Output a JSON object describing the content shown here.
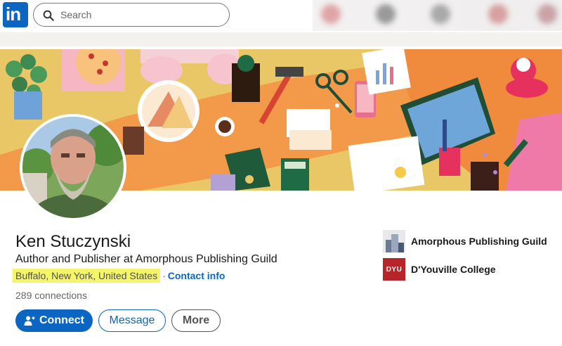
{
  "nav": {
    "logo_text": "in",
    "search_placeholder": "Search"
  },
  "profile": {
    "name": "Ken Stuczynski",
    "headline": "Author and Publisher at Amorphous Publishing Guild",
    "location": "Buffalo, New York, United States",
    "separator": "·",
    "contact_info": "Contact info",
    "connections": "289 connections"
  },
  "actions": {
    "connect": "Connect",
    "message": "Message",
    "more": "More"
  },
  "organizations": [
    {
      "name": "Amorphous Publishing Guild",
      "logo": "APG"
    },
    {
      "name": "D'Youville College",
      "logo": "DYU"
    }
  ],
  "colors": {
    "brand": "#0a66c2",
    "banner_bg": "#e9c766",
    "highlight": "#f5f56a",
    "dyu_red": "#b5252a"
  },
  "icons": [
    "linkedin-logo-icon",
    "search-icon",
    "add-person-icon"
  ]
}
